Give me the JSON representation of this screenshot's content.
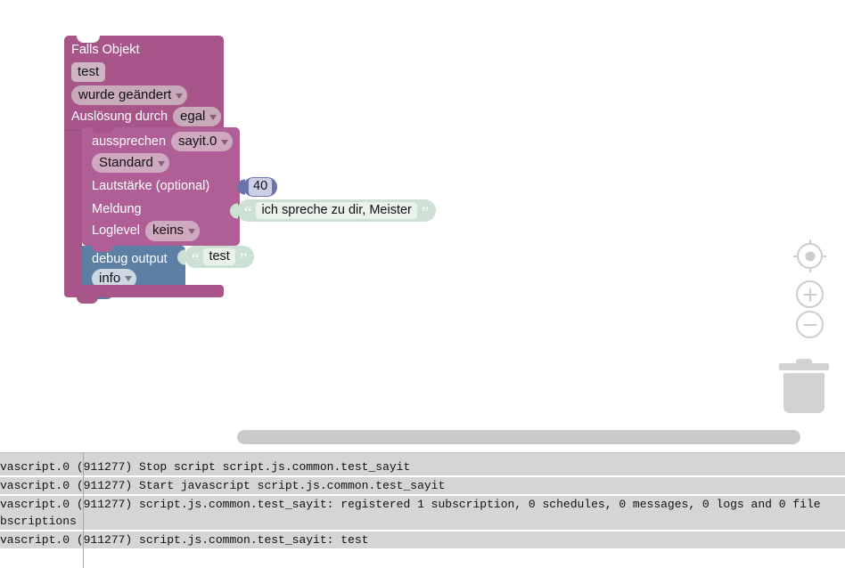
{
  "app": {
    "type": "blockly-visual-script-editor",
    "colors": {
      "event_block": "#a8568a",
      "say_block": "#b05f96",
      "debug_block": "#5d7fa4",
      "number_block": "#6a74a9",
      "string_block": "#cce0d4",
      "canvas_background": "#ffffff",
      "grid_mark": "#c9c9c9",
      "log_row_background": "#d5d5d5"
    }
  },
  "canvas": {
    "grid_spacing_px": 25,
    "grid_mark_icon": "plus-cross-mark",
    "scrollbar": {
      "orientation": "horizontal",
      "name": "canvas-horizontal-scrollbar"
    }
  },
  "blocks": {
    "event": {
      "title": "Falls Objekt",
      "object_field_value": "test",
      "trigger_dropdown_value": "wurde geändert",
      "source_label": "Auslösung durch",
      "source_dropdown_value": "egal"
    },
    "say": {
      "label": "aussprechen",
      "instance_dropdown_value": "sayit.0",
      "voice_dropdown_value": "Standard",
      "volume_label": "Lautstärke (optional)",
      "volume_value": "40",
      "message_label": "Meldung",
      "message_value": "ich spreche zu dir, Meister",
      "loglevel_label": "Loglevel",
      "loglevel_dropdown_value": "keins"
    },
    "debug": {
      "label": "debug output",
      "value": "test",
      "level_dropdown_value": "info"
    }
  },
  "controls": {
    "center_button": {
      "icon": "crosshair-target-icon",
      "label": ""
    },
    "zoom_in_button": {
      "icon": "plus-icon",
      "label": ""
    },
    "zoom_out_button": {
      "icon": "minus-icon",
      "label": ""
    },
    "trash_button": {
      "icon": "trash-can-icon",
      "label": ""
    }
  },
  "log_panel": {
    "rows": [
      {
        "text": "vascript.0 (911277) Stop script script.js.common.test_sayit",
        "wrapped": false
      },
      {
        "text": "vascript.0 (911277) Start javascript script.js.common.test_sayit",
        "wrapped": false
      },
      {
        "text": "vascript.0 (911277) script.js.common.test_sayit: registered 1 subscription, 0 schedules, 0 messages, 0 logs and 0 file\nbscriptions",
        "wrapped": true
      },
      {
        "text": "vascript.0 (911277) script.js.common.test_sayit: test",
        "wrapped": false
      }
    ]
  }
}
